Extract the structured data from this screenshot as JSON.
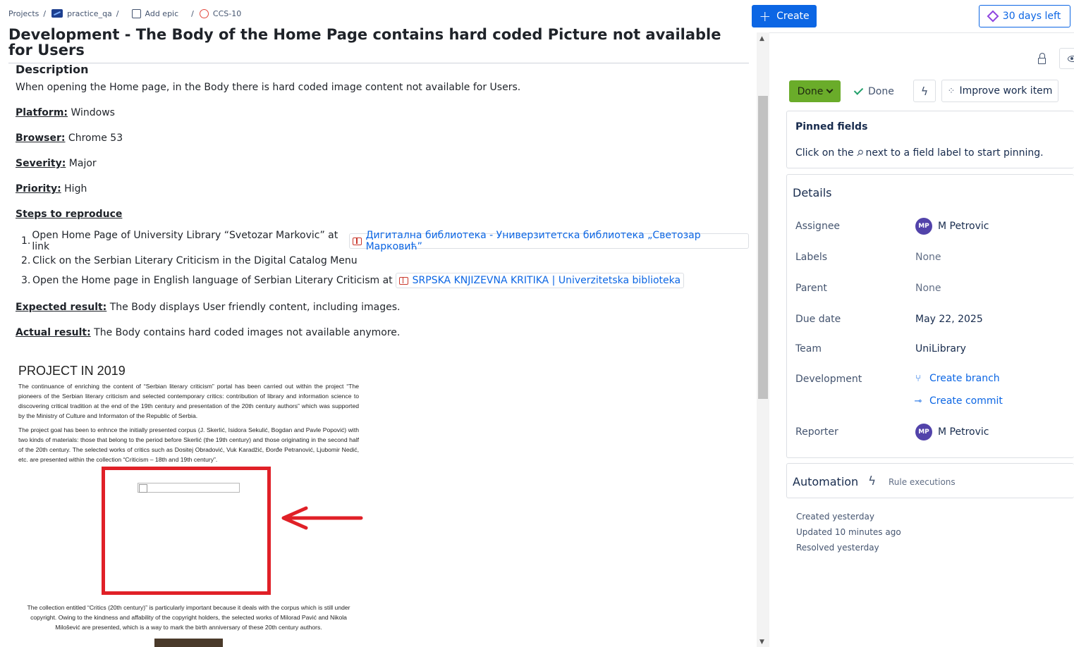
{
  "breadcrumb": {
    "projects": "Projects",
    "project": "practice_qa",
    "epic": "Add epic",
    "issue": "CCS-10"
  },
  "header": {
    "create_label": "Create",
    "trial_label": "30 days left"
  },
  "issue": {
    "title": "Development - The Body of the Home Page contains hard coded Picture not available for Users"
  },
  "description": {
    "heading": "Description",
    "intro": "When opening the Home page, in the Body there is hard coded image content not available for Users.",
    "platform_label": "Platform:",
    "platform_value": "Windows",
    "browser_label": "Browser:",
    "browser_value": "Chrome 53",
    "severity_label": "Severity:",
    "severity_value": "Major",
    "priority_label": "Priority:",
    "priority_value": "High",
    "steps_label": "Steps to reproduce",
    "steps": [
      {
        "num": "1.",
        "text": "Open Home Page of University Library “Svetozar Markovic” at link",
        "link": "Дигитална библиотека - Универзитетска библиотека „Светозар Марковић”"
      },
      {
        "num": "2.",
        "text": "Click on the Serbian Literary Criticism in the Digital Catalog Menu",
        "link": ""
      },
      {
        "num": "3.",
        "text": "Open the Home page in English language of Serbian Literary Criticism at",
        "link": "SRPSKA KNJIZEVNA KRITIKA | Univerzitetska biblioteka"
      }
    ],
    "expected_label": "Expected result:",
    "expected_value": "The Body displays User friendly content, including images.",
    "actual_label": "Actual result:",
    "actual_value": "The Body contains hard coded images not available anymore."
  },
  "embedded_image": {
    "heading": "PROJECT IN 2019",
    "para1": "The continuance of enriching the content of “Serbian literary criticism” portal has been carried out within the project “The pioneers of the Serbian literary criticism and selected contemporary critics: contribution of library and information science to discovering critical tradition at the end of the 19th century and presentation of the 20th century authors” which was supported by the Ministry of Culture and Informaton of the Republic of Serbia.",
    "para2": "The project goal has been to enhnce the initially presented corpus (J. Skerlić, Isidora Sekulić, Bogdan and Pavle Popović) with two kinds of materials: those that belong to the period before Skerlić (the 19th century) and those originating in the second half of the 20th century. The selected works of critics such as Dositej Obradović, Vuk Karadžić, Đorđe Petranović, Ljubomir Nedić, etc. are presented within the collection “Criticism – 18th and 19th century”.",
    "para3": "The collection entitled “Critics (20th century)” is particularly important because it deals with the corpus which is still under copyright. Owing to the kindness and affability of the copyright holders, the selected works of Milorad Pavić and Nikola Milošević are presented, which is a way to mark the birth anniversary of these 20th century authors."
  },
  "status": {
    "button_label": "Done",
    "state_label": "Done",
    "improve_label": "Improve work item"
  },
  "pinned": {
    "title": "Pinned fields",
    "hint_before": "Click on the",
    "hint_after": "next to a field label to start pinning."
  },
  "details": {
    "title": "Details",
    "assignee_label": "Assignee",
    "assignee_initials": "MP",
    "assignee_name": "M Petrovic",
    "labels_label": "Labels",
    "labels_value": "None",
    "parent_label": "Parent",
    "parent_value": "None",
    "due_label": "Due date",
    "due_value": "May 22, 2025",
    "team_label": "Team",
    "team_value": "UniLibrary",
    "development_label": "Development",
    "create_branch": "Create branch",
    "create_commit": "Create commit",
    "reporter_label": "Reporter",
    "reporter_initials": "MP",
    "reporter_name": "M Petrovic"
  },
  "automation": {
    "title": "Automation",
    "rule_label": "Rule executions"
  },
  "meta": {
    "created": "Created yesterday",
    "updated": "Updated 10 minutes ago",
    "resolved": "Resolved yesterday"
  },
  "colors": {
    "accent": "#0c66e4",
    "status_done": "#6aac2a",
    "avatar": "#5243aa",
    "annotation_red": "#e02027"
  }
}
